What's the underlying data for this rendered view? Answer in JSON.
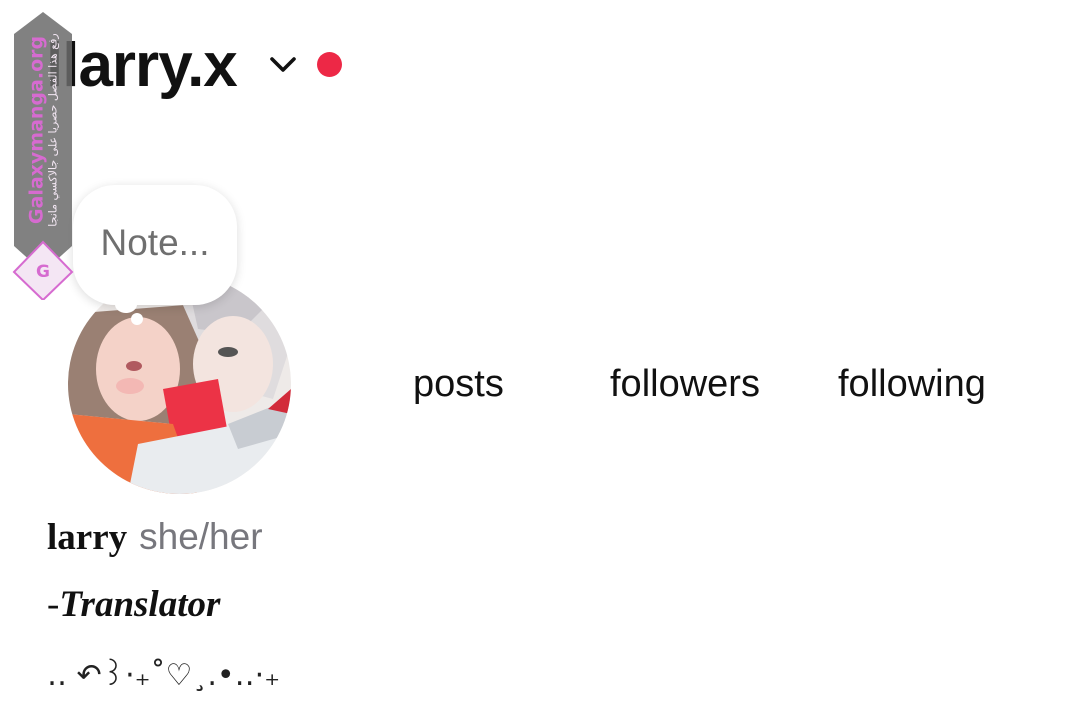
{
  "header": {
    "username": "llarry.x",
    "switch_icon": "chevron-down-icon",
    "notification_color": "#ed2846"
  },
  "watermark": {
    "site": "Galaxymanga.org",
    "note": "رفع هذا الفصل حصريا على جالاكسي مانجا",
    "logo_letter": "G"
  },
  "note_bubble": {
    "placeholder": "Note..."
  },
  "stats": {
    "posts_label": "posts",
    "followers_label": "followers",
    "following_label": "following"
  },
  "bio": {
    "name": "larry",
    "pronouns": "she/her",
    "role_prefix": "- ",
    "role": "Translator",
    "decoration": "‥ ↶꒱·₊˚♡¸.•‥·₊"
  }
}
